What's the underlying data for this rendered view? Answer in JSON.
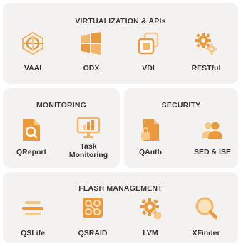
{
  "sections": {
    "virtualization": {
      "title": "VIRTUALIZATION & APIs",
      "items": [
        {
          "label": "VAAI",
          "icon": "vaai-cube-icon"
        },
        {
          "label": "ODX",
          "icon": "windows-icon"
        },
        {
          "label": "VDI",
          "icon": "vdi-stack-icon"
        },
        {
          "label": "RESTful",
          "icon": "gears-icon"
        }
      ]
    },
    "monitoring": {
      "title": "MONITORING",
      "items": [
        {
          "label": "QReport",
          "icon": "report-icon"
        },
        {
          "label": "Task\nMonitoring",
          "icon": "monitor-chart-icon"
        }
      ]
    },
    "security": {
      "title": "SECURITY",
      "items": [
        {
          "label": "QAuth",
          "icon": "auth-document-icon"
        },
        {
          "label": "SED & ISE",
          "icon": "users-icon"
        }
      ]
    },
    "flash": {
      "title": "FLASH MANAGEMENT",
      "items": [
        {
          "label": "QSLife",
          "icon": "lifespan-icon"
        },
        {
          "label": "QSRAID",
          "icon": "raid-icon"
        },
        {
          "label": "LVM",
          "icon": "lvm-gear-icon"
        },
        {
          "label": "XFinder",
          "icon": "magnifier-icon"
        }
      ]
    }
  },
  "colors": {
    "accent_dark": "#e89a3c",
    "accent_light": "#f6c98a",
    "panel_bg": "#f4f2f0"
  }
}
